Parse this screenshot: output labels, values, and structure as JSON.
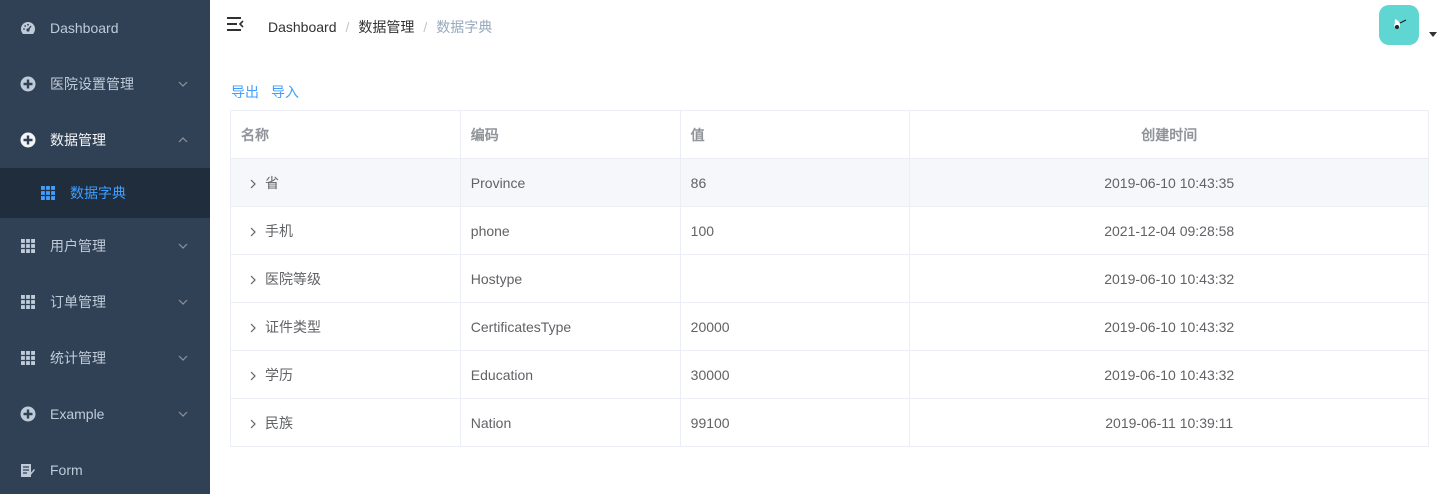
{
  "sidebar": {
    "items": [
      {
        "label": "Dashboard",
        "icon": "dashboard-icon"
      },
      {
        "label": "医院设置管理",
        "icon": "plus-circle-icon"
      },
      {
        "label": "数据管理",
        "icon": "plus-circle-icon",
        "expanded": true
      },
      {
        "label": "数据字典",
        "icon": "table-icon",
        "sub": true,
        "active": true
      },
      {
        "label": "用户管理",
        "icon": "table-icon"
      },
      {
        "label": "订单管理",
        "icon": "table-icon"
      },
      {
        "label": "统计管理",
        "icon": "table-icon"
      },
      {
        "label": "Example",
        "icon": "plus-circle-icon"
      },
      {
        "label": "Form",
        "icon": "form-icon"
      }
    ]
  },
  "navbar": {
    "breadcrumb": [
      "Dashboard",
      "数据管理",
      "数据字典"
    ],
    "separator": "/"
  },
  "actions": {
    "export": "导出",
    "import": "导入"
  },
  "table": {
    "columns": [
      "名称",
      "编码",
      "值",
      "创建时间"
    ],
    "rows": [
      {
        "name": "省",
        "code": "Province",
        "value": "86",
        "created": "2019-06-10 10:43:35"
      },
      {
        "name": "手机",
        "code": "phone",
        "value": "100",
        "created": "2021-12-04 09:28:58"
      },
      {
        "name": "医院等级",
        "code": "Hostype",
        "value": "",
        "created": "2019-06-10 10:43:32"
      },
      {
        "name": "证件类型",
        "code": "CertificatesType",
        "value": "20000",
        "created": "2019-06-10 10:43:32"
      },
      {
        "name": "学历",
        "code": "Education",
        "value": "30000",
        "created": "2019-06-10 10:43:32"
      },
      {
        "name": "民族",
        "code": "Nation",
        "value": "99100",
        "created": "2019-06-11 10:39:11"
      }
    ]
  },
  "colors": {
    "sidebar_bg": "#304156",
    "submenu_bg": "#1f2d3d",
    "accent": "#409eff",
    "avatar_bg": "#5fd6d2"
  }
}
